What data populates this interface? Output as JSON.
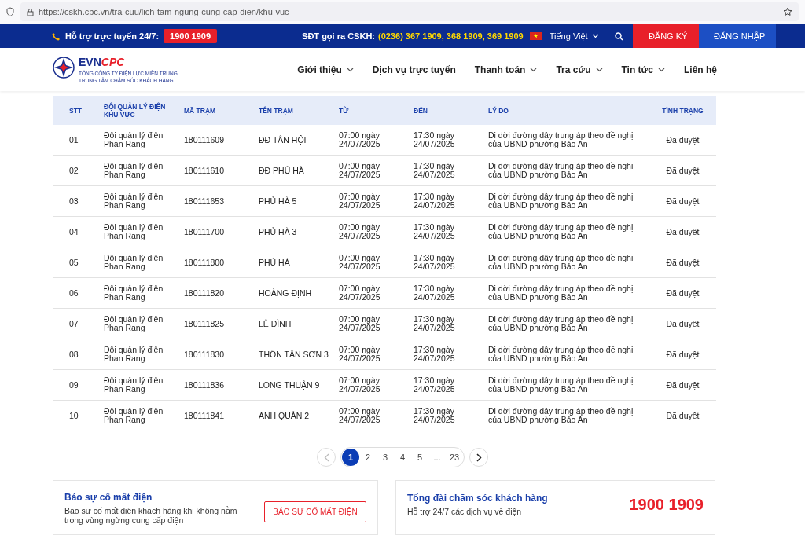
{
  "browser": {
    "url": "https://cskh.cpc.vn/tra-cuu/lich-tam-ngung-cung-cap-dien/khu-vuc"
  },
  "topbar": {
    "support_label": "Hỗ trợ trực tuyến 24/7:",
    "support_phone": "1900 1909",
    "call_label": "SĐT gọi ra CSKH:",
    "call_numbers": "(0236) 367 1909, 368 1909, 369 1909",
    "language": "Tiếng Việt",
    "register": "ĐĂNG KÝ",
    "login": "ĐĂNG NHẬP"
  },
  "logo": {
    "brand_a": "EVN",
    "brand_b": "CPC",
    "line1": "TỔNG CÔNG TY ĐIỆN LỰC MIỀN TRUNG",
    "line2": "TRUNG TÂM CHĂM SÓC KHÁCH HÀNG"
  },
  "nav": [
    {
      "label": "Giới thiệu",
      "dropdown": true
    },
    {
      "label": "Dịch vụ trực tuyến",
      "dropdown": false
    },
    {
      "label": "Thanh toán",
      "dropdown": true
    },
    {
      "label": "Tra cứu",
      "dropdown": true
    },
    {
      "label": "Tin tức",
      "dropdown": true
    },
    {
      "label": "Liên hệ",
      "dropdown": false
    }
  ],
  "table": {
    "columns": [
      "STT",
      "ĐỘI QUẢN LÝ ĐIỆN KHU VỰC",
      "MÃ TRẠM",
      "TÊN TRẠM",
      "TỪ",
      "ĐẾN",
      "LÝ DO",
      "TÌNH TRẠNG"
    ],
    "rows": [
      [
        "01",
        "Đội quản lý điện Phan Rang",
        "180111609",
        "ĐĐ TÂN HỘI",
        "07:00 ngày 24/07/2025",
        "17:30 ngày 24/07/2025",
        "Di dời đường dây trung áp theo đề nghị của UBND phường Bảo An",
        "Đã duyệt"
      ],
      [
        "02",
        "Đội quản lý điện Phan Rang",
        "180111610",
        "ĐĐ PHỦ HÀ",
        "07:00 ngày 24/07/2025",
        "17:30 ngày 24/07/2025",
        "Di dời đường dây trung áp theo đề nghị của UBND phường Bảo An",
        "Đã duyệt"
      ],
      [
        "03",
        "Đội quản lý điện Phan Rang",
        "180111653",
        "PHỦ HÀ 5",
        "07:00 ngày 24/07/2025",
        "17:30 ngày 24/07/2025",
        "Di dời đường dây trung áp theo đề nghị của UBND phường Bảo An",
        "Đã duyệt"
      ],
      [
        "04",
        "Đội quản lý điện Phan Rang",
        "180111700",
        "PHỦ HÀ 3",
        "07:00 ngày 24/07/2025",
        "17:30 ngày 24/07/2025",
        "Di dời đường dây trung áp theo đề nghị của UBND phường Bảo An",
        "Đã duyệt"
      ],
      [
        "05",
        "Đội quản lý điện Phan Rang",
        "180111800",
        "PHỦ HÀ",
        "07:00 ngày 24/07/2025",
        "17:30 ngày 24/07/2025",
        "Di dời đường dây trung áp theo đề nghị của UBND phường Bảo An",
        "Đã duyệt"
      ],
      [
        "06",
        "Đội quản lý điện Phan Rang",
        "180111820",
        "HOÀNG ĐỊNH",
        "07:00 ngày 24/07/2025",
        "17:30 ngày 24/07/2025",
        "Di dời đường dây trung áp theo đề nghị của UBND phường Bảo An",
        "Đã duyệt"
      ],
      [
        "07",
        "Đội quản lý điện Phan Rang",
        "180111825",
        "LÊ ĐÌNH",
        "07:00 ngày 24/07/2025",
        "17:30 ngày 24/07/2025",
        "Di dời đường dây trung áp theo đề nghị của UBND phường Bảo An",
        "Đã duyệt"
      ],
      [
        "08",
        "Đội quản lý điện Phan Rang",
        "180111830",
        "THÔN TÂN SƠN 3",
        "07:00 ngày 24/07/2025",
        "17:30 ngày 24/07/2025",
        "Di dời đường dây trung áp theo đề nghị của UBND phường Bảo An",
        "Đã duyệt"
      ],
      [
        "09",
        "Đội quản lý điện Phan Rang",
        "180111836",
        "LONG THUẬN 9",
        "07:00 ngày 24/07/2025",
        "17:30 ngày 24/07/2025",
        "Di dời đường dây trung áp theo đề nghị của UBND phường Bảo An",
        "Đã duyệt"
      ],
      [
        "10",
        "Đội quản lý điện Phan Rang",
        "180111841",
        "ANH QUÂN 2",
        "07:00 ngày 24/07/2025",
        "17:30 ngày 24/07/2025",
        "Di dời đường dây trung áp theo đề nghị của UBND phường Bảo An",
        "Đã duyệt"
      ]
    ]
  },
  "pagination": {
    "prev_disabled": true,
    "pages": [
      {
        "label": "1",
        "selected": true
      },
      {
        "label": "2",
        "selected": false
      },
      {
        "label": "3",
        "selected": false
      },
      {
        "label": "4",
        "selected": false
      },
      {
        "label": "5",
        "selected": false
      },
      {
        "label": "...",
        "selected": false
      },
      {
        "label": "23",
        "selected": false
      }
    ]
  },
  "report_card": {
    "title": "Báo sự cố mất điện",
    "text": "Báo sự cố mất điện khách hàng khi không nằm trong vùng ngừng cung cấp điện",
    "button": "BÁO SỰ CỐ MẤT ĐIỆN"
  },
  "hotline_card": {
    "title": "Tổng đài chăm sóc khách hàng",
    "text": "Hỗ trợ 24/7 các dịch vụ về điện",
    "phone": "1900 1909"
  }
}
